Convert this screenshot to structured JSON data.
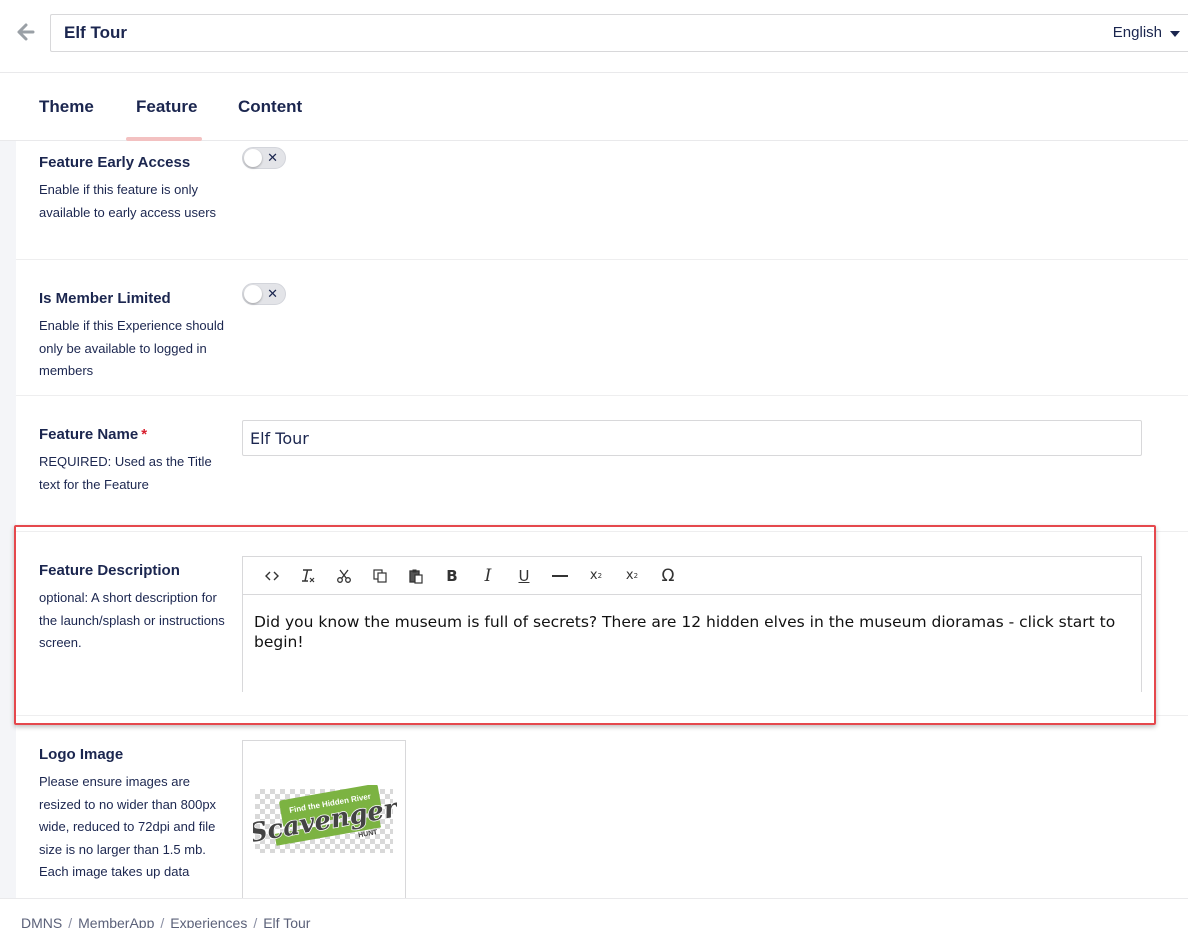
{
  "header": {
    "title": "Elf Tour",
    "language": "English"
  },
  "tabs": [
    {
      "label": "Theme",
      "active": false
    },
    {
      "label": "Feature",
      "active": true
    },
    {
      "label": "Content",
      "active": false
    }
  ],
  "fields": {
    "early_access": {
      "label": "Feature Early Access",
      "help": "Enable if this feature is only available to early access users",
      "enabled": false
    },
    "member_limited": {
      "label": "Is Member Limited",
      "help": "Enable if this Experience should only be available to logged in members",
      "enabled": false
    },
    "feature_name": {
      "label": "Feature Name",
      "required_mark": "*",
      "help": "REQUIRED: Used as the Title text for the Feature",
      "value": "Elf Tour"
    },
    "feature_description": {
      "label": "Feature Description",
      "help": "optional: A short description for the launch/splash or instructions screen.",
      "value": "Did you know the museum is full of secrets? There are 12 hidden elves in the museum dioramas - click start to begin!",
      "toolbar": [
        "source-icon",
        "remove-format-icon",
        "cut-icon",
        "copy-icon",
        "paste-icon",
        "bold-icon",
        "italic-icon",
        "underline-icon",
        "horizontal-line-icon",
        "subscript-icon",
        "superscript-icon",
        "special-char-icon"
      ]
    },
    "logo_image": {
      "label": "Logo Image",
      "help": "Please ensure images are resized to no wider than 800px wide, reduced to 72dpi and file size is no larger than 1.5 mb. Each image takes up data",
      "logo_text_top": "Find the Hidden River",
      "logo_text_main": "Scavenger",
      "logo_text_sub": "HUNT"
    }
  },
  "breadcrumbs": [
    "DMNS",
    "MemberApp",
    "Experiences",
    "Elf Tour"
  ],
  "colors": {
    "text": "#1b264f",
    "highlight": "#e5484d",
    "tab_underline": "#f3c1c1",
    "required": "#d8202f"
  }
}
